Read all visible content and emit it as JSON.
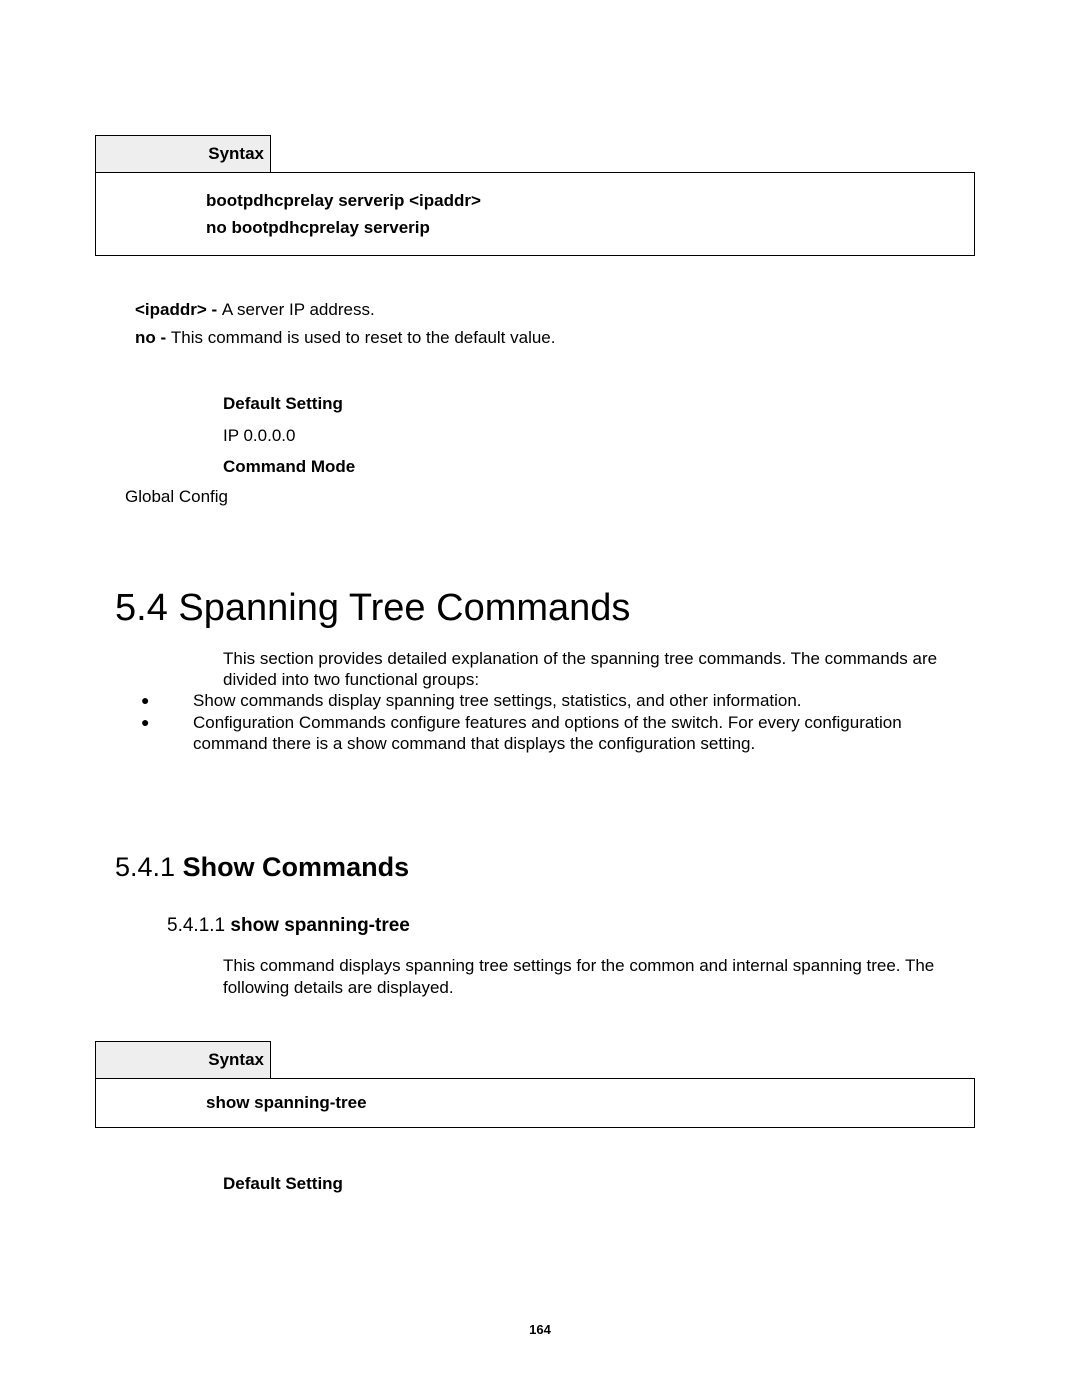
{
  "syntax1": {
    "header": "Syntax",
    "line1": "bootpdhcprelay serverip <ipaddr>",
    "line2": "no bootpdhcprelay serverip"
  },
  "params": {
    "ipaddr_label": "<ipaddr> - ",
    "ipaddr_desc": "A server IP address.",
    "no_label": "no - ",
    "no_desc": "This command is used to reset to the default value."
  },
  "defaults1": {
    "setting_label": "Default Setting",
    "setting_value": "IP 0.0.0.0",
    "mode_label": "Command Mode",
    "mode_value": "Global Config"
  },
  "section": {
    "title": "5.4 Spanning Tree Commands",
    "intro": "This section provides detailed explanation of the spanning tree commands. The commands are divided into two functional groups:",
    "bullet1": "Show commands display spanning tree settings, statistics, and other information.",
    "bullet2": "Configuration Commands configure features and options of the switch. For every configuration command there is a show command that displays the configuration setting."
  },
  "subsection": {
    "num": "5.4.1 ",
    "title": "Show Commands"
  },
  "cmd": {
    "num": "5.4.1.1 ",
    "title": "show spanning-tree",
    "desc": "This command displays spanning tree settings for the common and internal spanning tree. The following details are displayed."
  },
  "syntax2": {
    "header": "Syntax",
    "body": "show spanning-tree"
  },
  "defaults2": {
    "setting_label": "Default Setting"
  },
  "page_number": "164"
}
